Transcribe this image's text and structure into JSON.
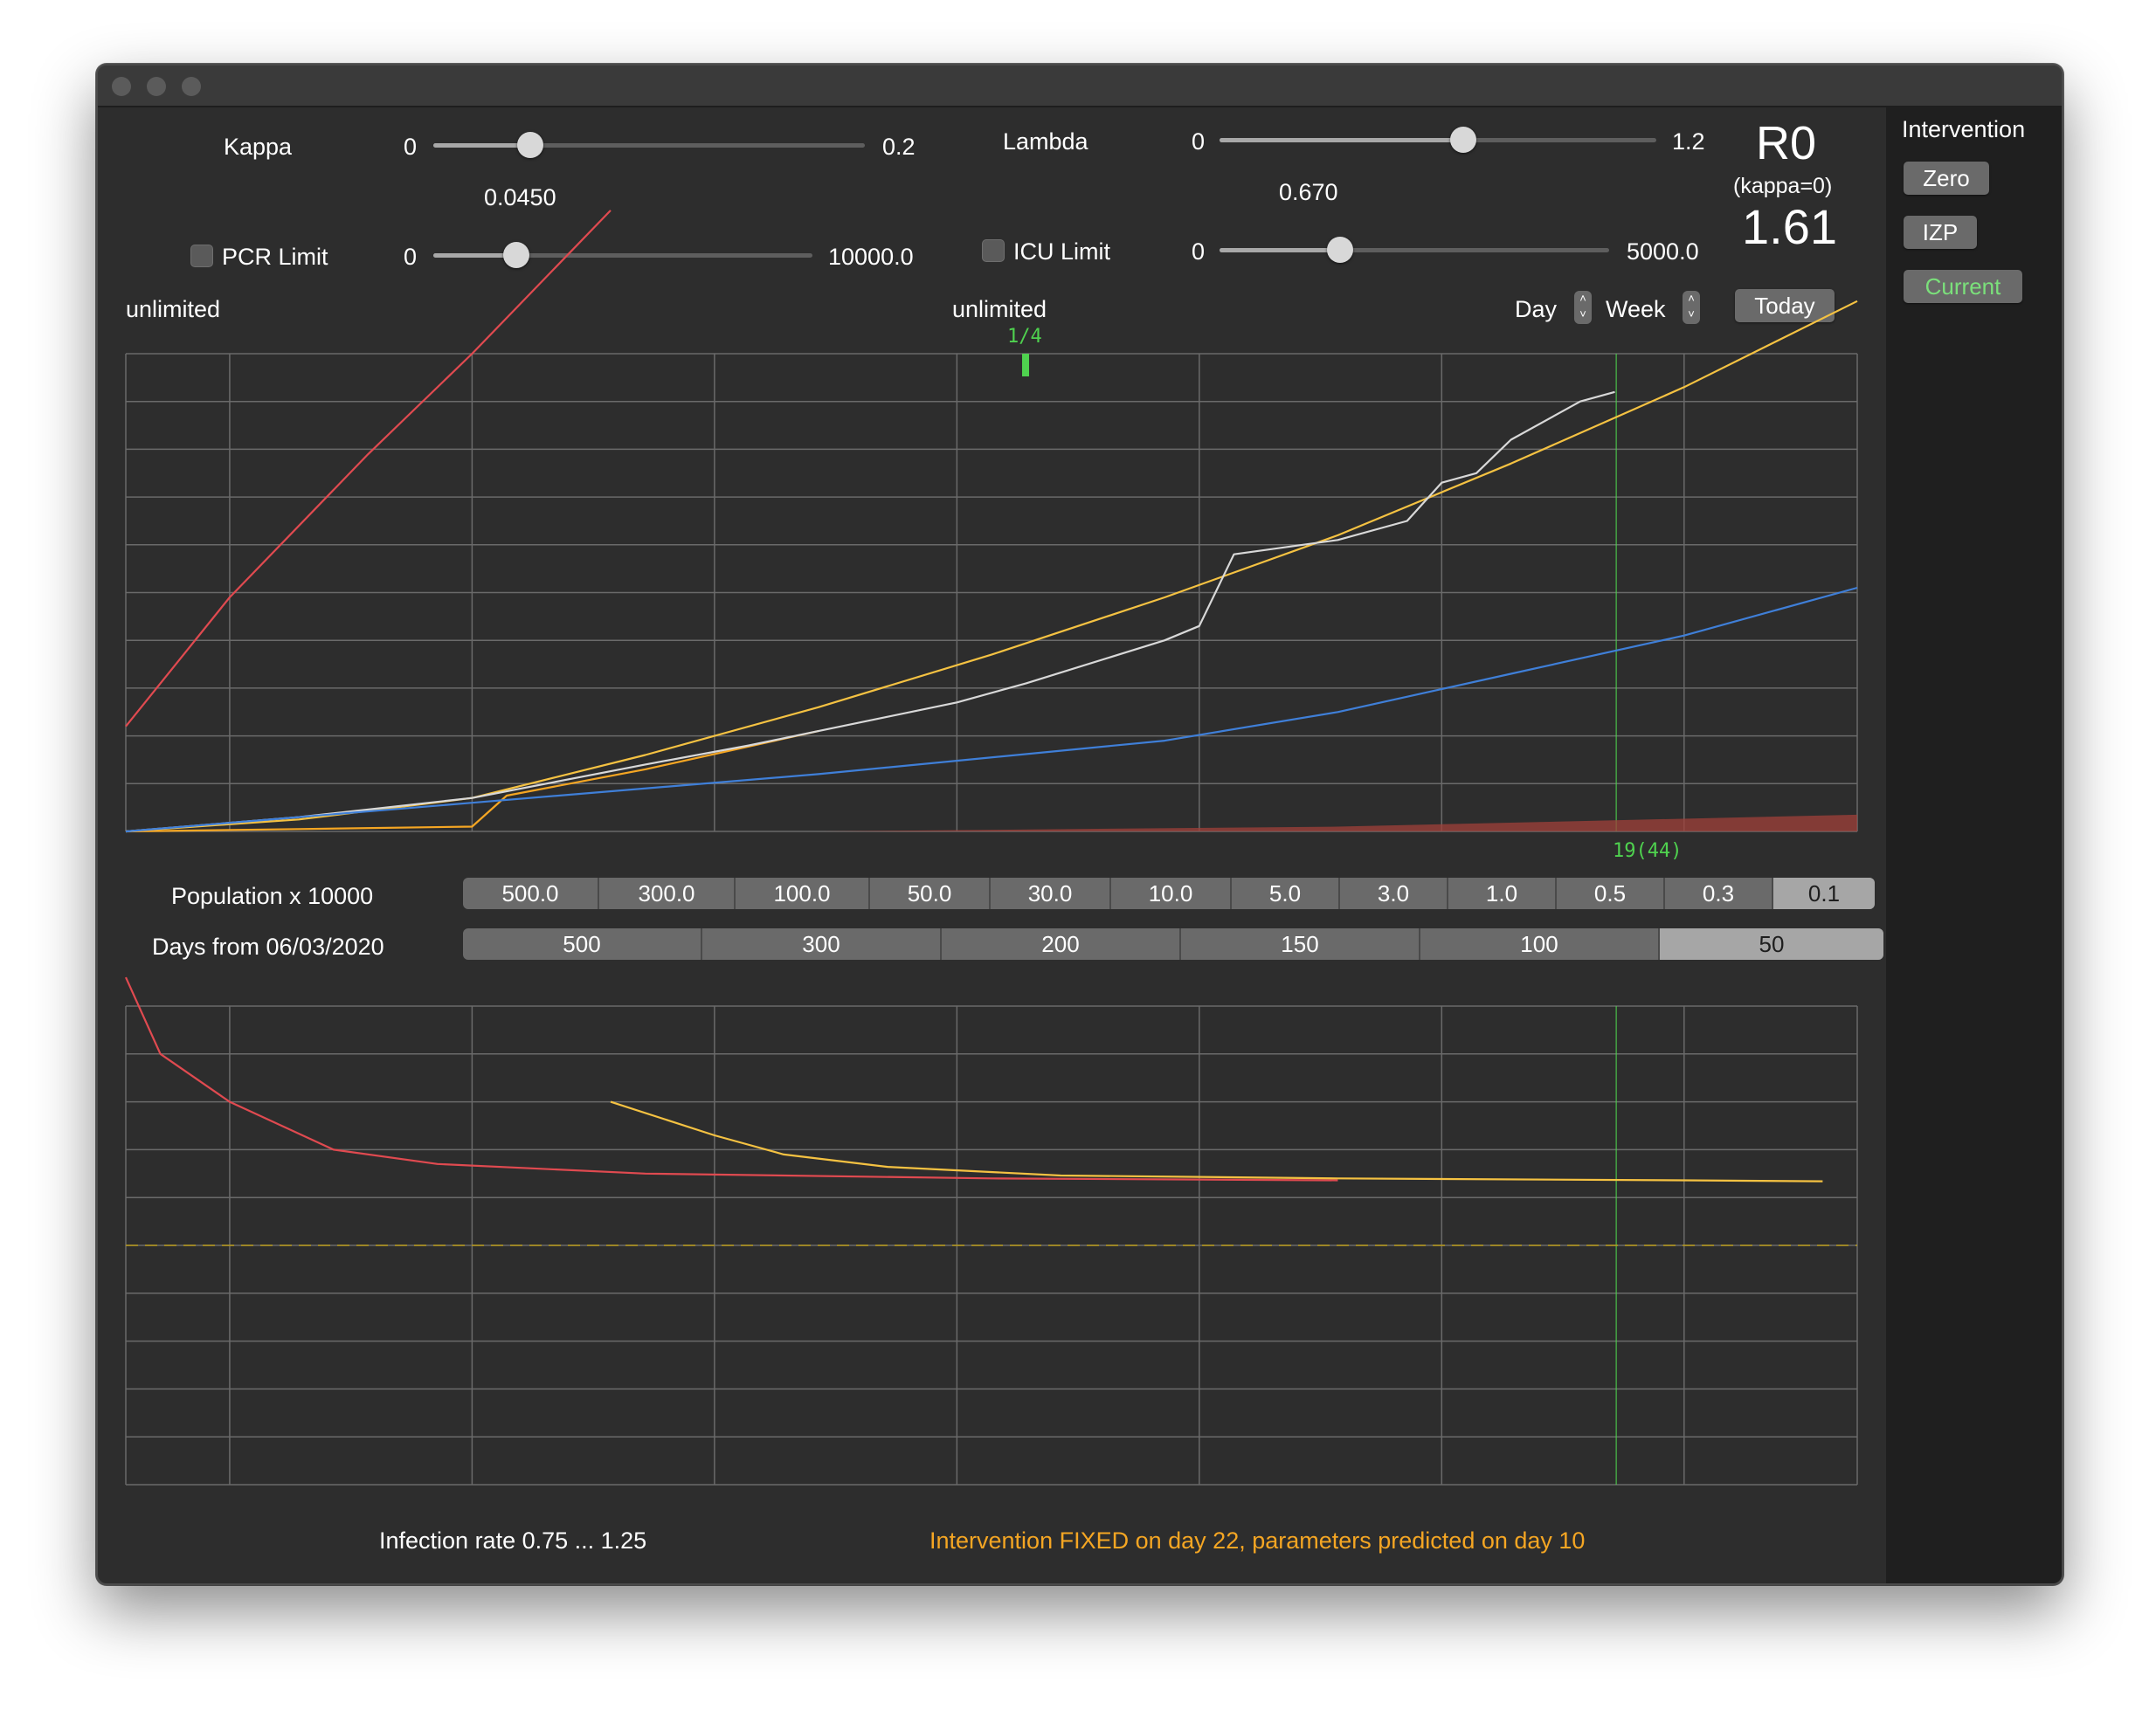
{
  "window": {
    "traffic_lights": [
      "close",
      "minimize",
      "zoom"
    ]
  },
  "kappa": {
    "label": "Kappa",
    "min": "0",
    "max": "0.2",
    "value": "0.0450",
    "fraction": 0.225
  },
  "lambda": {
    "label": "Lambda",
    "min": "0",
    "max": "1.2",
    "value": "0.670",
    "fraction": 0.558
  },
  "pcr": {
    "label": "PCR Limit",
    "min": "0",
    "max": "10000.0",
    "status": "unlimited",
    "checked": false,
    "fraction": 0.22
  },
  "icu": {
    "label": "ICU Limit",
    "min": "0",
    "max": "5000.0",
    "status": "unlimited",
    "checked": false,
    "fraction": 0.31
  },
  "r0": {
    "title": "R0",
    "subtitle": "(kappa=0)",
    "value": "1.61"
  },
  "stepping": {
    "day_label": "Day",
    "week_label": "Week",
    "today_label": "Today"
  },
  "intervention": {
    "title": "Intervention",
    "buttons": [
      {
        "label": "Zero",
        "color": "#ffffff"
      },
      {
        "label": "IZP",
        "color": "#ffffff"
      },
      {
        "label": "Current",
        "color": "#7be07b"
      }
    ]
  },
  "markers": {
    "top": "1/4",
    "bottom": "19(44)"
  },
  "population": {
    "label": "Population x 10000",
    "options": [
      "500.0",
      "300.0",
      "100.0",
      "50.0",
      "30.0",
      "10.0",
      "5.0",
      "3.0",
      "1.0",
      "0.5",
      "0.3",
      "0.1"
    ],
    "selected": "0.1"
  },
  "days": {
    "label": "Days from 06/03/2020",
    "options": [
      "500",
      "300",
      "200",
      "150",
      "100",
      "50"
    ],
    "selected": "50"
  },
  "footer": {
    "infection_rate": "Infection rate 0.75 ... 1.25",
    "status": "Intervention FIXED on day 22,  parameters predicted on day 10",
    "status_color": "#f5a623"
  },
  "colors": {
    "panel": "#2d2d2d",
    "grid": "#6a6a6a",
    "model_curve": "#f5c242",
    "observed_curve": "#d8d8d8",
    "blue_curve": "#3f7fd8",
    "red_curve": "#e04a50",
    "marker_green": "#4fd24f"
  },
  "chart_data": [
    {
      "type": "line",
      "title": "",
      "xlim": [
        0,
        50
      ],
      "ylim": [
        0,
        10
      ],
      "grid": true,
      "x_gridlines": [
        3,
        10,
        17,
        24,
        31,
        38,
        45
      ],
      "today_day": 44,
      "series": [
        {
          "color": "#f5c242",
          "x": [
            0,
            5,
            10,
            15,
            20,
            25,
            30,
            35,
            40,
            45,
            50
          ],
          "y": [
            0,
            0.25,
            0.7,
            1.6,
            2.6,
            3.7,
            4.9,
            6.2,
            7.7,
            9.3,
            11.1
          ]
        },
        {
          "color": "#f5a623",
          "x": [
            0,
            5,
            10,
            11,
            15,
            20
          ],
          "y": [
            0,
            0.05,
            0.1,
            0.75,
            1.3,
            2.1
          ]
        },
        {
          "color": "#d8d8d8",
          "x": [
            0,
            5,
            10,
            15,
            18,
            20,
            22,
            24,
            26,
            30,
            31,
            32,
            35,
            37,
            38,
            39,
            40,
            42,
            43
          ],
          "y": [
            0,
            0.3,
            0.7,
            1.4,
            1.8,
            2.1,
            2.4,
            2.7,
            3.1,
            4.0,
            4.3,
            5.8,
            6.1,
            6.5,
            7.3,
            7.5,
            8.2,
            9.0,
            9.2
          ]
        },
        {
          "color": "#3f7fd8",
          "x": [
            0,
            10,
            20,
            30,
            35,
            40,
            45,
            50
          ],
          "y": [
            0,
            0.6,
            1.2,
            1.9,
            2.5,
            3.3,
            4.1,
            5.1
          ]
        },
        {
          "color": "#e04a50",
          "x": [
            0,
            3,
            7,
            10,
            14
          ],
          "y": [
            2.2,
            4.9,
            7.9,
            10.0,
            13.0
          ]
        }
      ],
      "area": {
        "color": "#a0403a",
        "x": [
          20,
          35,
          50
        ],
        "y": [
          0,
          0.1,
          0.35
        ]
      }
    },
    {
      "type": "line",
      "title": "",
      "xlim": [
        0,
        50
      ],
      "ylim": [
        0.75,
        1.25
      ],
      "grid": true,
      "series": [
        {
          "color": "#e04a50",
          "x": [
            0,
            1,
            3,
            6,
            9,
            15,
            25,
            35
          ],
          "y": [
            1.28,
            1.2,
            1.15,
            1.1,
            1.085,
            1.075,
            1.07,
            1.068
          ]
        },
        {
          "color": "#f5c242",
          "x": [
            14,
            17,
            19,
            22,
            27,
            35,
            45,
            49
          ],
          "y": [
            1.15,
            1.115,
            1.095,
            1.082,
            1.073,
            1.07,
            1.068,
            1.067
          ]
        },
        {
          "color": "#b89a1a",
          "x": [
            0,
            50
          ],
          "y": [
            1.0,
            1.0
          ],
          "dashed": true
        }
      ]
    }
  ]
}
